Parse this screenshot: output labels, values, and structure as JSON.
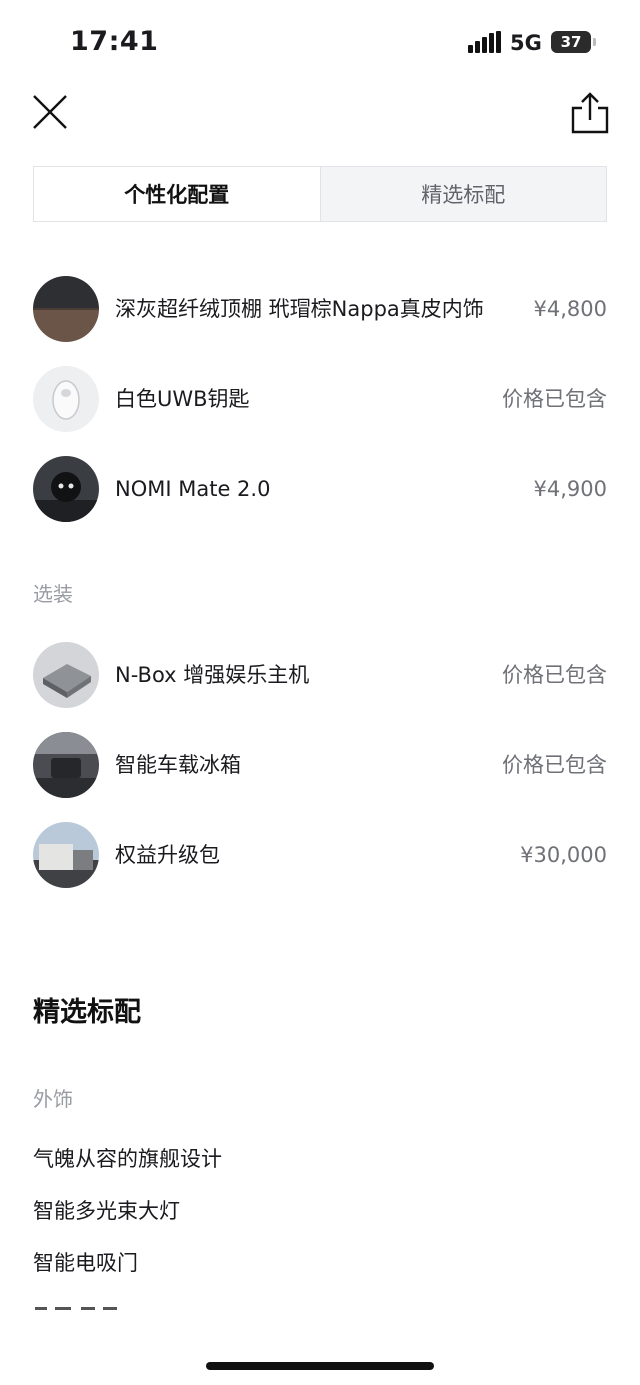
{
  "status": {
    "time": "17:41",
    "network": "5G",
    "battery": "37"
  },
  "tabs": [
    {
      "label": "个性化配置",
      "active": true
    },
    {
      "label": "精选标配",
      "active": false
    }
  ],
  "selected_items": [
    {
      "name": "深灰超纤绒顶棚 玳瑁棕Nappa真皮内饰",
      "price": "¥4,800"
    },
    {
      "name": "白色UWB钥匙",
      "price": "价格已包含"
    },
    {
      "name": "NOMI Mate 2.0",
      "price": "¥4,900"
    }
  ],
  "options_label": "选装",
  "option_items": [
    {
      "name": "N-Box 增强娱乐主机",
      "price": "价格已包含"
    },
    {
      "name": "智能车载冰箱",
      "price": "价格已包含"
    },
    {
      "name": "权益升级包",
      "price": "¥30,000"
    }
  ],
  "standard": {
    "title": "精选标配",
    "exterior_label": "外饰",
    "features": [
      "气魄从容的旗舰设计",
      "智能多光束大灯",
      "智能电吸门"
    ]
  },
  "colors": {
    "text": "#1b1b1f",
    "muted": "#9a9ca3",
    "price": "#6f7177",
    "tab_bg": "#f3f4f6"
  }
}
